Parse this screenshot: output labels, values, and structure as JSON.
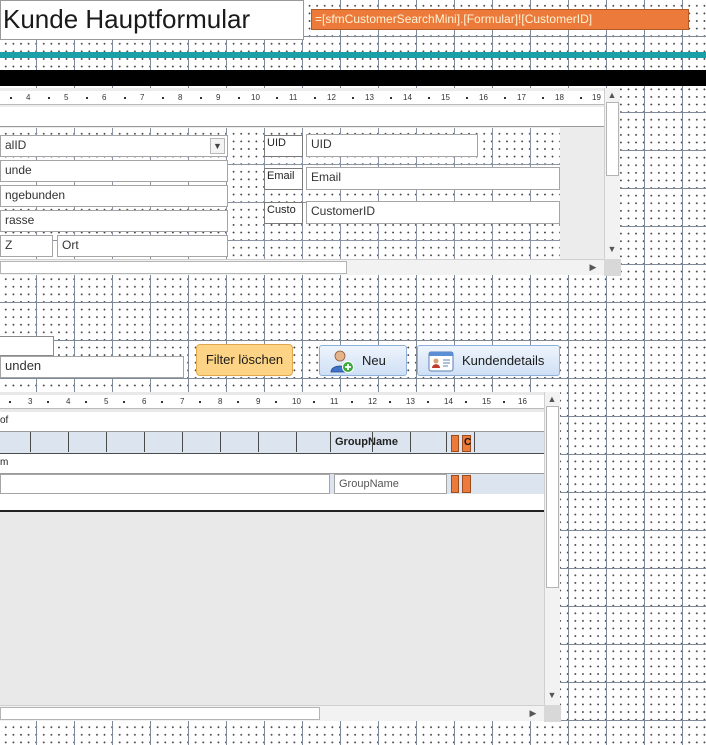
{
  "header": {
    "title": "Kunde Hauptformular",
    "customer_expression": "=[sfmCustomerSearchMini].[Formular]![CustomerID]",
    "colors": {
      "accent_bar": "#1aa0a6",
      "dark_bar": "#000000",
      "expression_bg": "#ec7a3a"
    }
  },
  "top_subform": {
    "ruler_ticks": [
      "4",
      "5",
      "6",
      "7",
      "8",
      "9",
      "10",
      "11",
      "12",
      "13",
      "14",
      "15",
      "16",
      "17",
      "18",
      "19"
    ],
    "combo_value": "alID",
    "fields_left": [
      "unde",
      "ngebunden",
      "rasse"
    ],
    "plz_label": "Z",
    "ort_value": "Ort",
    "labels_right": [
      "UID",
      "Email",
      "Custo"
    ],
    "fields_right": [
      "UID",
      "Email",
      "CustomerID"
    ]
  },
  "search": {
    "input_value": "unden",
    "filter_button": "Filter löschen",
    "new_button": "Neu",
    "details_button": "Kundendetails"
  },
  "bottom_subform": {
    "ruler_ticks": [
      "3",
      "4",
      "5",
      "6",
      "7",
      "8",
      "9",
      "10",
      "11",
      "12",
      "13",
      "14",
      "15",
      "16"
    ],
    "section_header": "of",
    "column_header_group": "GroupName",
    "column_header_c": "C",
    "section_detail": "m",
    "field_group": "GroupName"
  }
}
